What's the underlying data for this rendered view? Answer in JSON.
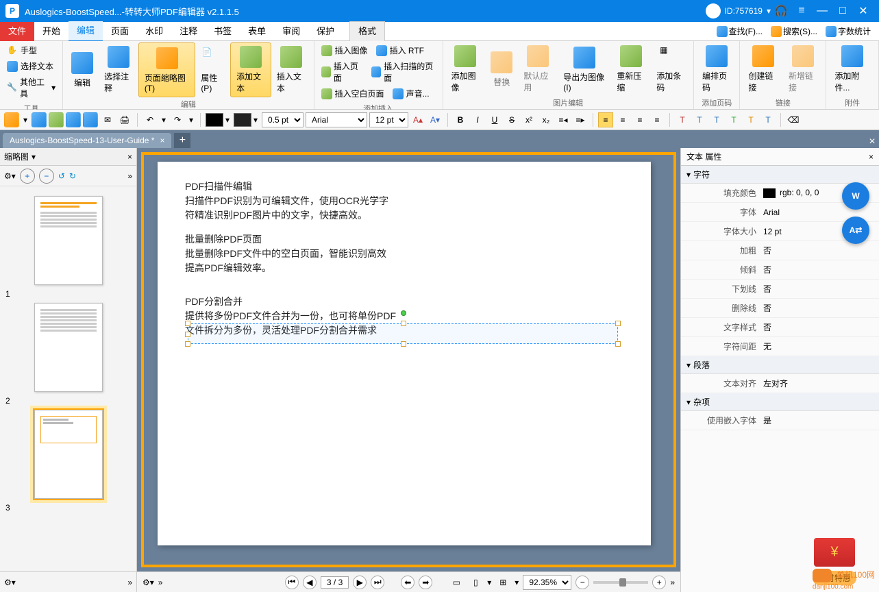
{
  "title": "Auslogics-BoostSpeed...-转转大师PDF编辑器 v2.1.1.5",
  "user_id": "ID:757619",
  "menu": {
    "file": "文件",
    "start": "开始",
    "edit": "编辑",
    "page": "页面",
    "watermark": "水印",
    "comment": "注释",
    "bookmark": "书签",
    "form": "表单",
    "review": "审阅",
    "protect": "保护",
    "format": "格式"
  },
  "topright": {
    "find": "查找(F)...",
    "search": "搜索(S)...",
    "wordcount": "字数统计"
  },
  "ribbon": {
    "tools_label": "工具",
    "tools": {
      "hand": "手型",
      "seltext": "选择文本",
      "other": "其他工具"
    },
    "edit_label": "编辑",
    "edit": {
      "edit": "编辑",
      "selannot": "选择注释",
      "thumb": "页面缩略图(T)",
      "prop": "属性(P)",
      "addtext": "添加文本",
      "instext": "插入文本"
    },
    "insert_label": "添加插入",
    "insert": {
      "insimg": "插入图像",
      "insrtf": "插入 RTF",
      "inspage": "插入页面",
      "insscan": "插入扫描的页面",
      "insblank": "插入空白页面",
      "sound": "声音..."
    },
    "image_label": "图片编辑",
    "image": {
      "addimg": "添加图像",
      "replace": "替换",
      "default": "默认应用",
      "export": "导出为图像(I)",
      "recomp": "重新压缩",
      "barcode": "添加条码"
    },
    "pagenum_label": "添加页码",
    "pagenum": {
      "arrange": "编排页码"
    },
    "link_label": "链接",
    "link": {
      "create": "创建链接",
      "newlink": "新增链接"
    },
    "attach_label": "附件",
    "attach": {
      "add": "添加附件..."
    }
  },
  "fmt": {
    "linew": "0.5 pt",
    "font": "Arial",
    "size": "12 pt"
  },
  "doctab": {
    "name": "Auslogics-BoostSpeed-13-User-Guide *"
  },
  "thumb_title": "缩略图",
  "pages": [
    "1",
    "2",
    "3"
  ],
  "doc": {
    "h1": "PDF扫描件编辑",
    "p1a": "扫描件PDF识别为可编辑文件，使用OCR光学字",
    "p1b": "符精准识别PDF图片中的文字，快捷高效。",
    "h2": "批量删除PDF页面",
    "p2a": "批量删除PDF文件中的空白页面，智能识别高效",
    "p2b": "提高PDF编辑效率。",
    "h3": "PDF分割合并",
    "p3a": "提供将多份PDF文件合并为一份，也可将单份PDF",
    "p3b": "文件拆分为多份，灵活处理PDF分割合并需求"
  },
  "status": {
    "page": "3",
    "total": "3",
    "zoom": "92.35%"
  },
  "props": {
    "title": "文本 属性",
    "char": "字符",
    "fillcolor_k": "填充颜色",
    "fillcolor_v": "rgb: 0, 0, 0",
    "font_k": "字体",
    "font_v": "Arial",
    "size_k": "字体大小",
    "size_v": "12 pt",
    "bold_k": "加粗",
    "bold_v": "否",
    "italic_k": "倾斜",
    "italic_v": "否",
    "under_k": "下划线",
    "under_v": "否",
    "strike_k": "删除线",
    "strike_v": "否",
    "style_k": "文字样式",
    "style_v": "否",
    "spacing_k": "字符间距",
    "spacing_v": "无",
    "para": "段落",
    "align_k": "文本对齐",
    "align_v": "左对齐",
    "misc": "杂项",
    "embed_k": "使用嵌入字体",
    "embed_v": "是"
  },
  "promo": "限时特惠",
  "watermark": {
    "name": "单机100网",
    "url": "danji100.com"
  }
}
